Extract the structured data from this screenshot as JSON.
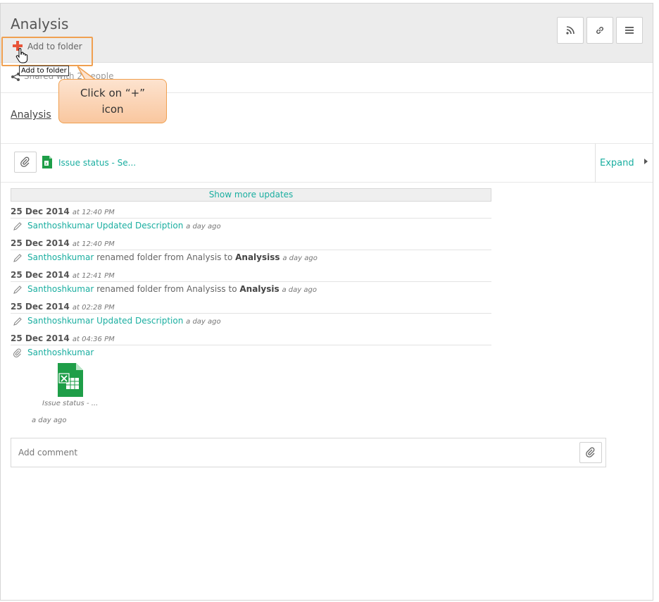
{
  "header": {
    "title": "Analysis",
    "add_to_folder_label": "Add to folder",
    "tooltip": "Add to folder",
    "buttons": [
      "rss-icon",
      "link-icon",
      "menu-icon"
    ]
  },
  "shared": {
    "text": "Shared with 2 people"
  },
  "callout": {
    "line1": "Click on “+”",
    "line2": "icon"
  },
  "section": {
    "label": "Analysis"
  },
  "attachment": {
    "name": "Issue status - Se...",
    "expand_label": "Expand"
  },
  "updates": {
    "show_more": "Show more updates",
    "entries": [
      {
        "date": "25 Dec 2014",
        "time": "at 12:40 PM",
        "user": "Santhoshkumar",
        "action": "Updated Description",
        "action_style": "link",
        "ago": "a day ago"
      },
      {
        "date": "25 Dec 2014",
        "time": "at 12:40 PM",
        "user": "Santhoshkumar",
        "action": "renamed folder from Analysis to",
        "target": "Analysiss",
        "ago": "a day ago"
      },
      {
        "date": "25 Dec 2014",
        "time": "at 12:41 PM",
        "user": "Santhoshkumar",
        "action": "renamed folder from Analysiss to",
        "target": "Analysis",
        "ago": "a day ago"
      },
      {
        "date": "25 Dec 2014",
        "time": "at 02:28 PM",
        "user": "Santhoshkumar",
        "action": "Updated Description",
        "action_style": "link",
        "ago": "a day ago"
      },
      {
        "date": "25 Dec 2014",
        "time": "at 04:36 PM",
        "user": "Santhoshkumar"
      }
    ],
    "file": {
      "caption": "Issue status - ...",
      "ago": "a day ago"
    }
  },
  "comment": {
    "placeholder": "Add comment"
  },
  "colors": {
    "accent": "#1aaea0",
    "callout_border": "#f0a050",
    "plus": "#e8553a"
  }
}
